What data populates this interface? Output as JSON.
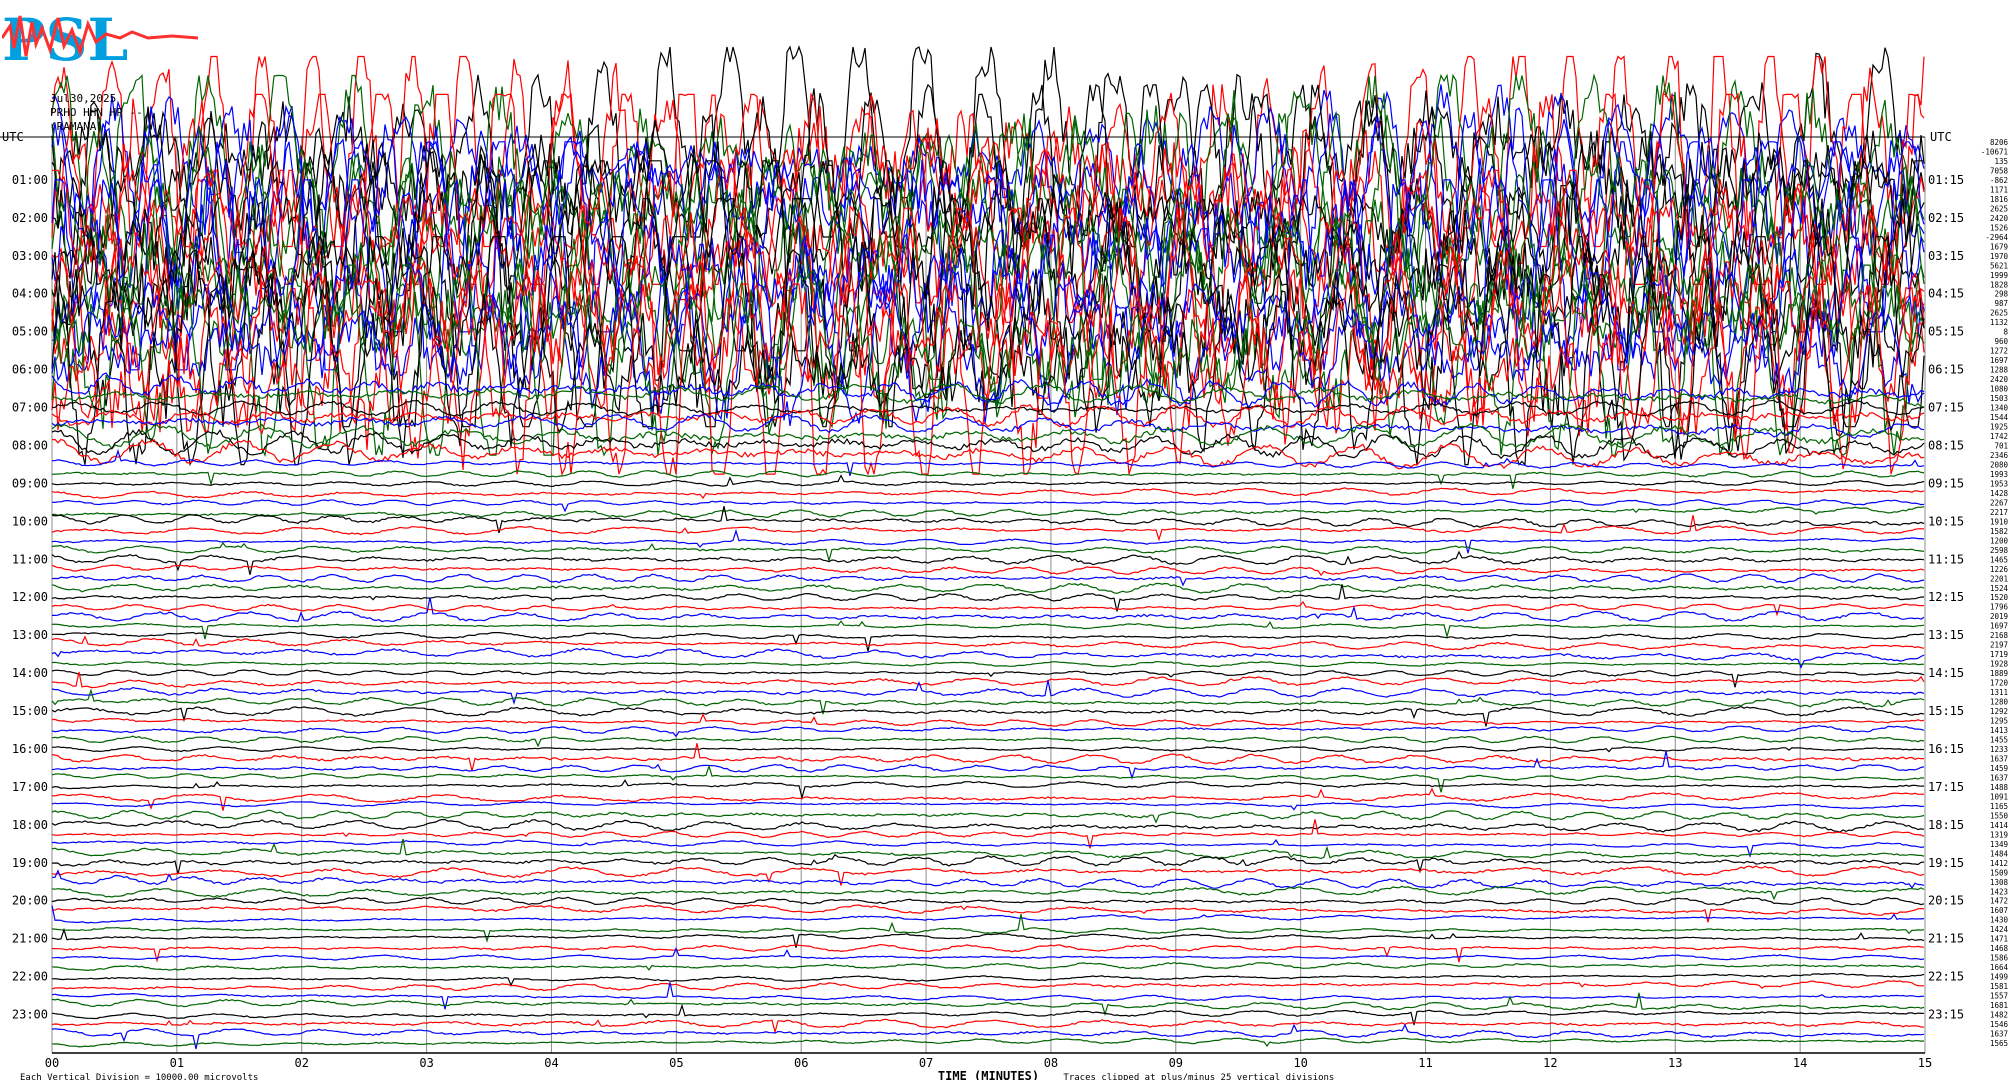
{
  "header": {
    "logo_text": "PSL",
    "date": "Jul30,2025",
    "station": "PRHO HHN HP --",
    "network": "(RAMANA)"
  },
  "colors": {
    "black": "#000000",
    "red": "#ff0000",
    "blue": "#0000ff",
    "green": "#006400",
    "grid": "#8c8c8c",
    "logo_red": "#ff3030",
    "logo_cyan": "#00a0e0"
  },
  "chart_data": {
    "type": "line",
    "title": "",
    "xlabel": "TIME (MINUTES)",
    "ylabel": "UTC",
    "right_ylabel": "UTC",
    "xlim": [
      0,
      15
    ],
    "x_ticks": [
      "00",
      "01",
      "02",
      "03",
      "04",
      "05",
      "06",
      "07",
      "08",
      "09",
      "10",
      "11",
      "12",
      "13",
      "14",
      "15"
    ],
    "left_hour_labels": [
      "01:00",
      "02:00",
      "03:00",
      "04:00",
      "05:00",
      "06:00",
      "07:00",
      "08:00",
      "09:00",
      "10:00",
      "11:00",
      "12:00",
      "13:00",
      "14:00",
      "15:00",
      "16:00",
      "17:00",
      "18:00",
      "19:00",
      "20:00",
      "21:00",
      "22:00",
      "23:00"
    ],
    "right_hour_labels": [
      "01:15",
      "02:15",
      "03:15",
      "04:15",
      "05:15",
      "06:15",
      "07:15",
      "08:15",
      "09:15",
      "10:15",
      "11:15",
      "12:15",
      "13:15",
      "14:15",
      "15:15",
      "16:15",
      "17:15",
      "18:15",
      "19:15",
      "20:15",
      "21:15",
      "22:15",
      "23:15"
    ],
    "trace_color_cycle": [
      "black",
      "red",
      "blue",
      "green"
    ],
    "trace_offsets": [
      "8206",
      "-10671",
      "135",
      "7058",
      "-862",
      "1171",
      "1816",
      "2625",
      "2420",
      "1526",
      "-2964",
      "1679",
      "1970",
      "5621",
      "1999",
      "1828",
      "298",
      "987",
      "2625",
      "1132",
      "8",
      "960",
      "1272",
      "1697",
      "1288",
      "2420",
      "1080",
      "1503",
      "1340",
      "1544",
      "1925",
      "1742",
      "701",
      "2346",
      "2080",
      "1993",
      "1953",
      "1428",
      "2267",
      "2217",
      "1910",
      "1582",
      "1200",
      "2598",
      "1465",
      "1226",
      "2201",
      "1524",
      "1520",
      "1796",
      "2019",
      "1697",
      "2168",
      "2197",
      "1719",
      "1928",
      "1889",
      "1720",
      "1311",
      "1280",
      "1292",
      "1295",
      "1413",
      "1455",
      "1233",
      "1637",
      "1459",
      "1637",
      "1488",
      "1091",
      "1165",
      "1550",
      "1414",
      "1319",
      "1349",
      "1484",
      "1412",
      "1509",
      "1308",
      "1423",
      "1472",
      "1607",
      "1430",
      "1424",
      "1471",
      "1468",
      "1586",
      "1664",
      "1499",
      "1581",
      "1557",
      "1681",
      "1482",
      "1546",
      "1637",
      "1565"
    ],
    "scale_note": "Each Vertical Division = 10000.00 microvolts",
    "clip_note": "Traces clipped at plus/minus 25 vertical divisions",
    "grid": true
  }
}
